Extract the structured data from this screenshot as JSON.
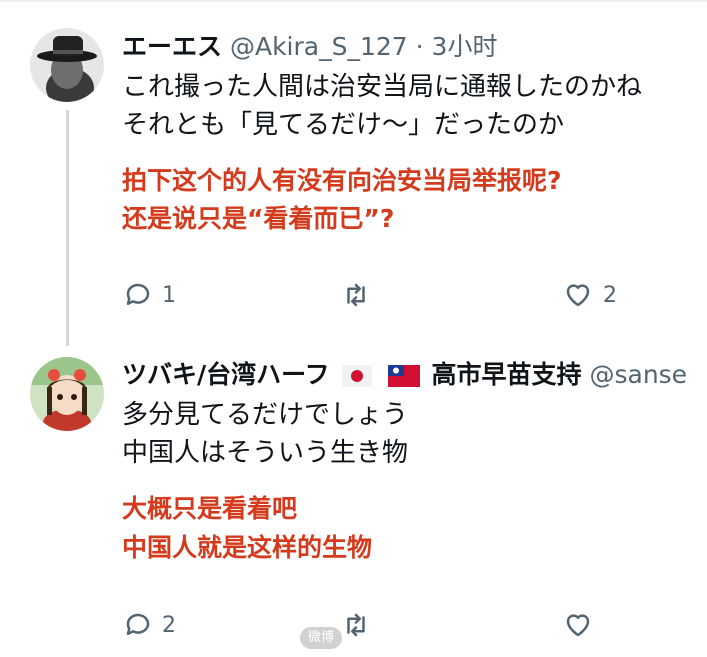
{
  "tweets": [
    {
      "author_name": "エーエス",
      "handle": "@Akira_S_127",
      "separator": "·",
      "time": "3小时",
      "lines": [
        "これ撮った人間は治安当局に通報したのかね",
        "それとも「見てるだけ〜」だったのか"
      ],
      "translation": [
        "拍下这个的人有没有向治安当局举报呢?",
        "还是说只是“看着而已”?"
      ],
      "reply_count": "1",
      "retweet_count": "",
      "like_count": "2",
      "avatar_icon": "hat-man-avatar"
    },
    {
      "author_name": "ツバキ/台湾ハーフ",
      "name_suffix": "高市早苗支持",
      "handle": "@sanse",
      "lines": [
        "多分見てるだけでしょう",
        "中国人はそういう生き物"
      ],
      "translation": [
        "大概只是看着吧",
        "中国人就是这样的生物"
      ],
      "reply_count": "2",
      "retweet_count": "",
      "like_count": "",
      "avatar_icon": "anime-girl-avatar"
    }
  ],
  "icons": {
    "reply": "reply-bubble-icon",
    "retweet": "retweet-icon",
    "like": "heart-icon",
    "flags": [
      "japan-flag-icon",
      "taiwan-flag-icon"
    ]
  },
  "colors": {
    "translation": "#d53a1c",
    "secondary": "#536471",
    "thread_line": "#cfd9de"
  },
  "watermark": "微博"
}
